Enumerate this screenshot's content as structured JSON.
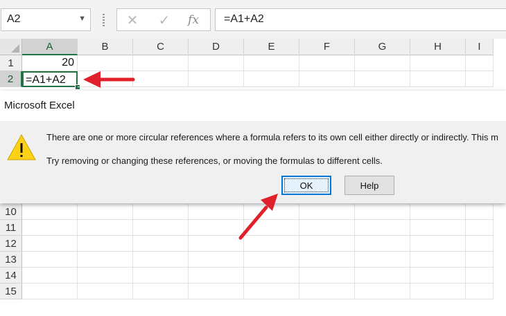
{
  "name_box": {
    "value": "A2",
    "dropdown_icon": "chevron-down-icon"
  },
  "formula_bar": {
    "cancel_icon": "x-icon",
    "enter_icon": "check-icon",
    "function_label": "fx",
    "formula": "=A1+A2"
  },
  "columns": [
    "A",
    "B",
    "C",
    "D",
    "E",
    "F",
    "G",
    "H",
    "I"
  ],
  "rows_top": [
    "1",
    "2"
  ],
  "rows_bottom": [
    "10",
    "11",
    "12",
    "13",
    "14",
    "15"
  ],
  "cells": {
    "A1": "20",
    "A2": "=A1+A2"
  },
  "dialog": {
    "title": "Microsoft Excel",
    "icon": "warning-icon",
    "message_line1": "There are one or more circular references where a formula refers to its own cell either directly or indirectly. This m",
    "message_line2": "Try removing or changing these references, or moving the formulas to different cells.",
    "ok_label": "OK",
    "help_label": "Help"
  },
  "colors": {
    "excel_green": "#217346",
    "annotation_red": "#e0202a",
    "button_focus_blue": "#0078d7"
  }
}
